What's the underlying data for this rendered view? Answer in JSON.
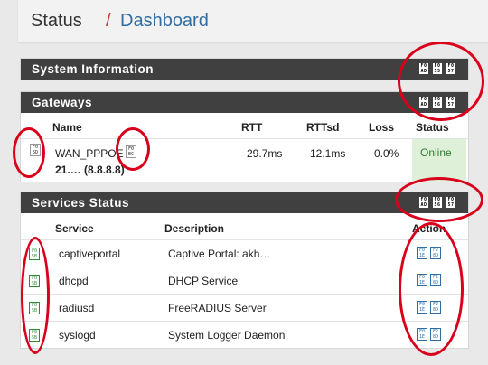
{
  "breadcrumb": {
    "root": "Status",
    "separator": "/",
    "current": "Dashboard"
  },
  "system_information": {
    "title": "System Information"
  },
  "gateways": {
    "title": "Gateways",
    "columns": [
      "Name",
      "RTT",
      "RTTsd",
      "Loss",
      "Status"
    ],
    "rows": [
      {
        "name": "WAN_PPPOE",
        "address": "21.…  (8.8.8.8)",
        "rtt": "29.7ms",
        "rttsd": "12.1ms",
        "loss": "0.0%",
        "status": "Online"
      }
    ]
  },
  "services": {
    "title": "Services Status",
    "columns": [
      "Service",
      "Description",
      "Action"
    ],
    "rows": [
      {
        "service": "captiveportal",
        "description": "Captive Portal: akh…"
      },
      {
        "service": "dhcpd",
        "description": "DHCP Service"
      },
      {
        "service": "radiusd",
        "description": "FreeRADIUS Server"
      },
      {
        "service": "syslogd",
        "description": "System Logger Daemon"
      }
    ]
  },
  "colors": {
    "header_bar": "#404040",
    "link": "#2f6da3",
    "online_bg": "#dff0d8",
    "annotation": "#d9001b"
  },
  "icons": [
    "settings-icon",
    "collapse-icon",
    "close-icon",
    "status-icon",
    "restart-icon",
    "stop-icon"
  ]
}
